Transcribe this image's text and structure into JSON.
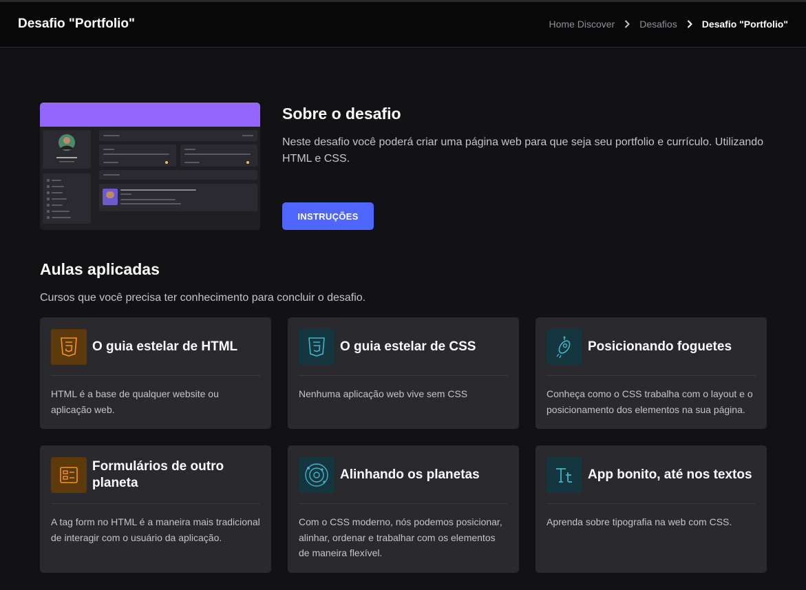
{
  "header": {
    "title": "Desafio \"Portfolio\"",
    "breadcrumb": [
      "Home Discover",
      "Desafios",
      "Desafio \"Portfolio\""
    ]
  },
  "about": {
    "title": "Sobre o desafio",
    "description": "Neste desafio você poderá criar uma página web para que seja seu portfolio e currículo. Utilizando HTML e CSS.",
    "button_label": "INSTRUÇÕES"
  },
  "lessons": {
    "title": "Aulas aplicadas",
    "subtitle": "Cursos que você precisa ter conhecimento para concluir o desafio.",
    "cards": [
      {
        "title": "O guia estelar de HTML",
        "description": "HTML é a base de qualquer website ou aplicação web.",
        "icon": "html5-icon",
        "accent": "#f7931e"
      },
      {
        "title": "O guia estelar de CSS",
        "description": "Nenhuma aplicação web vive sem CSS",
        "icon": "css3-icon",
        "accent": "#3fb6c9"
      },
      {
        "title": "Posicionando foguetes",
        "description": "Conheça como o CSS trabalha com o layout e o posicionamento dos elementos na sua página.",
        "icon": "rocket-icon",
        "accent": "#3fb6c9"
      },
      {
        "title": "Formulários de outro planeta",
        "description": "A tag form no HTML é a maneira mais tradicional de interagir com o usuário da aplicação.",
        "icon": "form-icon",
        "accent": "#f7931e"
      },
      {
        "title": "Alinhando os planetas",
        "description": "Com o CSS moderno, nós podemos posicionar, alinhar, ordenar e trabalhar com os elementos de maneira flexível.",
        "icon": "orbit-icon",
        "accent": "#3fb6c9"
      },
      {
        "title": "App bonito, até nos textos",
        "description": "Aprenda sobre tipografia na web com CSS.",
        "icon": "typography-icon",
        "accent": "#3fb6c9"
      }
    ]
  },
  "colors": {
    "background": "#121214",
    "card": "#29292e",
    "primary_button": "#4f66ff",
    "preview_banner": "#9466ff"
  }
}
